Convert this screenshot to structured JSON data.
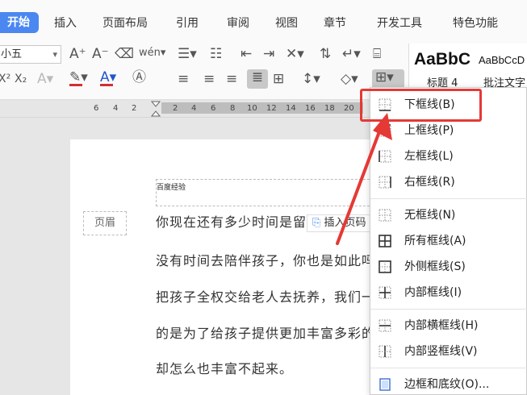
{
  "menu": {
    "tabs": [
      "开始",
      "插入",
      "页面布局",
      "引用",
      "审阅",
      "视图",
      "章节",
      "开发工具",
      "特色功能"
    ]
  },
  "ribbon": {
    "font_size": "小五",
    "style_preview_1": "AaBbC",
    "style_preview_2": "AaBbCcD",
    "style_label_1": "标题 4",
    "style_label_2": "批注文字"
  },
  "ruler": {
    "numbers": [
      "6",
      "4",
      "2",
      "2",
      "4",
      "6",
      "8",
      "10",
      "12",
      "14",
      "16",
      "18",
      "20"
    ]
  },
  "document": {
    "header_text": "百度经验",
    "header_tag": "页眉",
    "insert_page_label": "插入页码",
    "lines": [
      "你现在还有多少时间是留给你的家人的",
      "没有时间去陪伴孩子，你也是如此吗",
      "把孩子全权交给老人去抚养，我们一",
      "的是为了给孩子提供更加丰富多彩的",
      "却怎么也丰富不起来。"
    ]
  },
  "dropdown": {
    "items": [
      {
        "label": "下框线(B)",
        "icon": "border-bottom-icon"
      },
      {
        "label": "上框线(P)",
        "icon": "border-top-icon"
      },
      {
        "label": "左框线(L)",
        "icon": "border-left-icon"
      },
      {
        "label": "右框线(R)",
        "icon": "border-right-icon"
      },
      {
        "label": "无框线(N)",
        "icon": "border-none-icon"
      },
      {
        "label": "所有框线(A)",
        "icon": "border-all-icon"
      },
      {
        "label": "外侧框线(S)",
        "icon": "border-outside-icon"
      },
      {
        "label": "内部框线(I)",
        "icon": "border-inside-icon"
      },
      {
        "label": "内部横框线(H)",
        "icon": "border-inside-horizontal-icon"
      },
      {
        "label": "内部竖框线(V)",
        "icon": "border-inside-vertical-icon"
      },
      {
        "label": "边框和底纹(O)...",
        "icon": "border-shading-icon"
      }
    ]
  },
  "colors": {
    "accent": "#4a87f0",
    "highlight": "#e53935",
    "font_color_bar": "#d32f2f",
    "highlight_color_bar": "#d32f2f"
  }
}
